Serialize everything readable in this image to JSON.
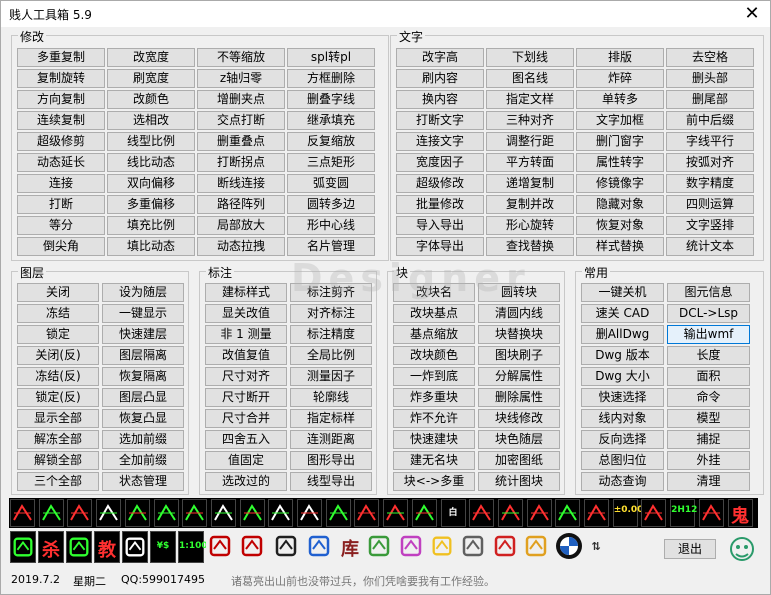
{
  "window": {
    "title": "贱人工具箱 5.9",
    "close_glyph": "✕"
  },
  "groups": {
    "modify": {
      "title": "修改",
      "buttons": [
        "多重复制",
        "改宽度",
        "不等缩放",
        "spl转pl",
        "复制旋转",
        "刷宽度",
        "z轴归零",
        "方框删除",
        "方向复制",
        "改颜色",
        "增删夹点",
        "删叠字线",
        "连续复制",
        "选相改",
        "交点打断",
        "继承填充",
        "超级修剪",
        "线型比例",
        "删重叠点",
        "反复缩放",
        "动态延长",
        "线比动态",
        "打断拐点",
        "三点矩形",
        "连接",
        "双向偏移",
        "断线连接",
        "弧变圆",
        "打断",
        "多重偏移",
        "路径阵列",
        "圆转多边",
        "等分",
        "填充比例",
        "局部放大",
        "形中心线",
        "倒尖角",
        "填比动态",
        "动态拉拽",
        "名片管理"
      ]
    },
    "text": {
      "title": "文字",
      "buttons": [
        "改字高",
        "下划线",
        "排版",
        "去空格",
        "刷内容",
        "图名线",
        "炸碎",
        "删头部",
        "换内容",
        "指定文样",
        "单转多",
        "删尾部",
        "打断文字",
        "三种对齐",
        "文字加框",
        "前中后缀",
        "连接文字",
        "调整行距",
        "删门窗字",
        "字线平行",
        "宽度因子",
        "平方转面",
        "属性转字",
        "按弧对齐",
        "超级修改",
        "递增复制",
        "修镜像字",
        "数字精度",
        "批量修改",
        "复制并改",
        "隐藏对象",
        "四则运算",
        "导入导出",
        "形心旋转",
        "恢复对象",
        "文字竖排",
        "字体导出",
        "查找替换",
        "样式替换",
        "统计文本"
      ]
    },
    "layer": {
      "title": "图层",
      "buttons": [
        "关闭",
        "设为随层",
        "冻结",
        "一键显示",
        "锁定",
        "快速建层",
        "关闭(反)",
        "图层隔离",
        "冻结(反)",
        "恢复隔离",
        "锁定(反)",
        "图层凸显",
        "显示全部",
        "恢复凸显",
        "解冻全部",
        "选加前缀",
        "解锁全部",
        "全加前缀",
        "三个全部",
        "状态管理"
      ]
    },
    "dim": {
      "title": "标注",
      "buttons": [
        "建标样式",
        "标注剪齐",
        "显关改值",
        "对齐标注",
        "非 1 测量",
        "标注精度",
        "改值复值",
        "全局比例",
        "尺寸对齐",
        "测量因子",
        "尺寸断开",
        "轮廓线",
        "尺寸合并",
        "指定标样",
        "四舍五入",
        "连测距离",
        "值固定",
        "图形导出",
        "选改过的",
        "线型导出"
      ]
    },
    "block": {
      "title": "块",
      "buttons": [
        "改块名",
        "圆转块",
        "改块基点",
        "清圆内线",
        "基点缩放",
        "块替换块",
        "改块颜色",
        "图块刷子",
        "一炸到底",
        "分解属性",
        "炸多重块",
        "删除属性",
        "炸不允许",
        "块线修改",
        "快速建块",
        "块色随层",
        "建无名块",
        "加密图纸",
        "块<->多重",
        "统计图块"
      ]
    },
    "common": {
      "title": "常用",
      "buttons": [
        "一键关机",
        "图元信息",
        "速关 CAD",
        "DCL->Lsp",
        "删AllDwg",
        "输出wmf",
        "Dwg 版本",
        "长度",
        "Dwg 大小",
        "面积",
        "快速选择",
        "命令",
        "线内对象",
        "模型",
        "反向选择",
        "捕捉",
        "总图归位",
        "外挂",
        "动态查询",
        "清理"
      ]
    }
  },
  "toolbar": {
    "row1_icons": [
      "dim-circle-icon",
      "break-line-icon",
      "diagonal-line-icon",
      "arrow-left-icon",
      "leader-icon",
      "step-line-icon",
      "stair-icon",
      "bracket-icon",
      "dim-extend-icon",
      "gear-dim-icon",
      "face-icon",
      "needle-icon",
      "dim-bar-icon",
      "arrow-target-icon",
      "slash-icon",
      "block-white-icon",
      "square-icon",
      "square-split-icon",
      "rect-icon",
      "double-circle-icon",
      "arrow-box-icon",
      "dim-value-icon",
      "dim-angle-icon",
      "dim-2h12-icon",
      "ground-icon",
      "ghost-char-icon"
    ],
    "row1_labels": {
      "dim_value": "±0.00",
      "dim_2h12": "2H12",
      "ghost": "鬼",
      "block_white": "白"
    },
    "row2_icons": [
      "wave-line-icon",
      "kill-icon",
      "hatch-icon",
      "teach-icon",
      "angle-icon",
      "yen-icon",
      "scale-icon",
      "seal-icon",
      "brush-seal-icon",
      "dragon-icon",
      "pen-icon",
      "library-icon",
      "recycle-icon",
      "folder-icon",
      "bulb-icon",
      "printer-icon",
      "lamp-icon",
      "worker-icon",
      "bmw-icon",
      "more-icon"
    ],
    "row2_labels": {
      "kill": "杀",
      "teach": "教",
      "yen": "¥$",
      "scale": "1:100",
      "library": "库",
      "more": "⇅"
    },
    "exit_label": "退出"
  },
  "status": {
    "date": "2019.7.2",
    "weekday": "星期二",
    "qq": "QQ:599017495",
    "message": "诸葛亮出山前也没带过兵，你们凭啥要我有工作经验。"
  },
  "watermark": "Designer",
  "colors": {
    "accent": "#0078d7",
    "toolbar_bg": "#000000",
    "icon_red": "#ff2020",
    "icon_green": "#20ff20"
  }
}
